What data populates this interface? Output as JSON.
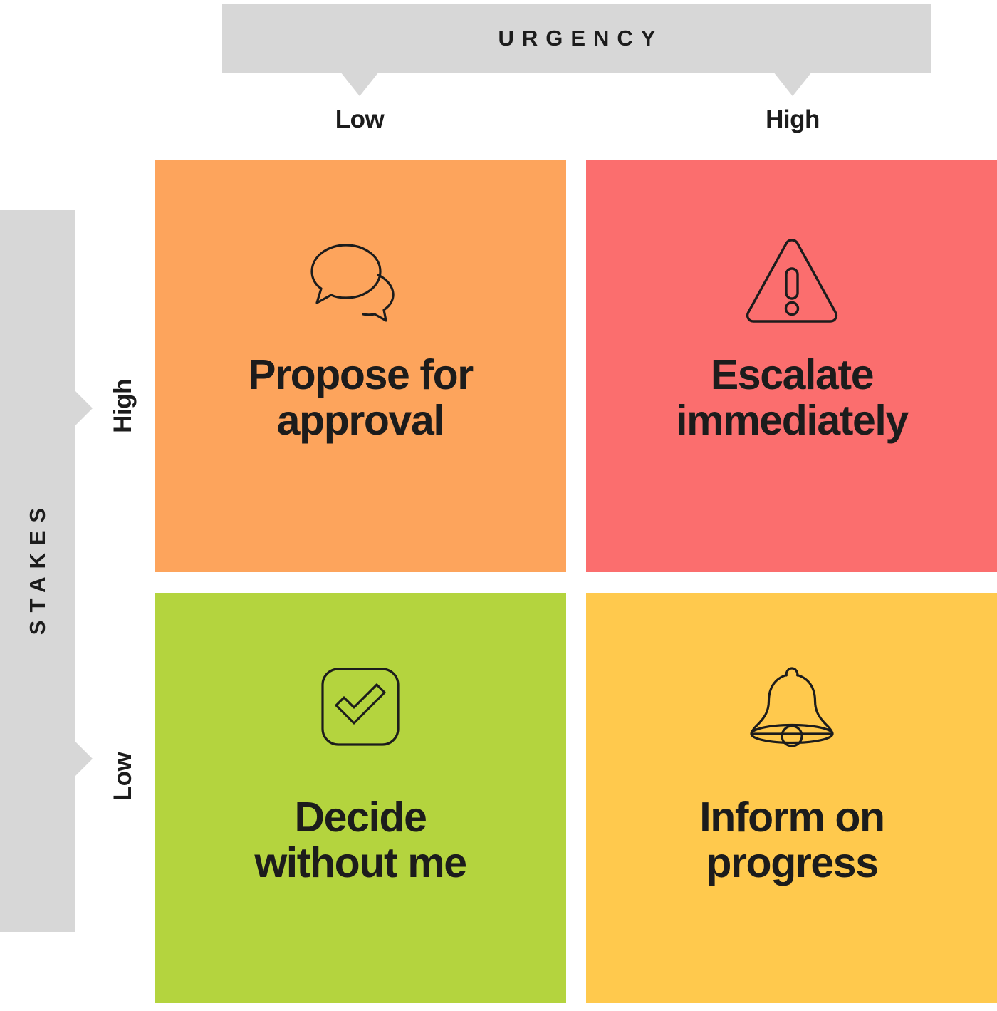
{
  "diagram": {
    "title_x_axis": "URGENCY",
    "title_y_axis": "STAKES",
    "x_ticks": {
      "left": "Low",
      "right": "High"
    },
    "y_ticks": {
      "top": "High",
      "bottom": "Low"
    },
    "colors": {
      "axis_bar": "#d7d7d7",
      "text": "#1c1c1c",
      "q1": "#fda45c",
      "q2": "#fb6e6e",
      "q3": "#b4d43e",
      "q4": "#ffc94d",
      "background": "#ffffff"
    },
    "quadrants": [
      {
        "id": "high-stakes-low-urgency",
        "label": "Propose for approval",
        "label_line1": "Propose for",
        "label_line2": "approval",
        "icon": "speech-bubbles-icon",
        "color": "#fda45c",
        "stakes": "High",
        "urgency": "Low"
      },
      {
        "id": "high-stakes-high-urgency",
        "label": "Escalate immediately",
        "label_line1": "Escalate",
        "label_line2": "immediately",
        "icon": "warning-triangle-icon",
        "color": "#fb6e6e",
        "stakes": "High",
        "urgency": "High"
      },
      {
        "id": "low-stakes-low-urgency",
        "label": "Decide without me",
        "label_line1": "Decide",
        "label_line2": "without me",
        "icon": "check-square-icon",
        "color": "#b4d43e",
        "stakes": "Low",
        "urgency": "Low"
      },
      {
        "id": "low-stakes-high-urgency",
        "label": "Inform on progress",
        "label_line1": "Inform on",
        "label_line2": "progress",
        "icon": "bell-icon",
        "color": "#ffc94d",
        "stakes": "Low",
        "urgency": "High"
      }
    ]
  }
}
